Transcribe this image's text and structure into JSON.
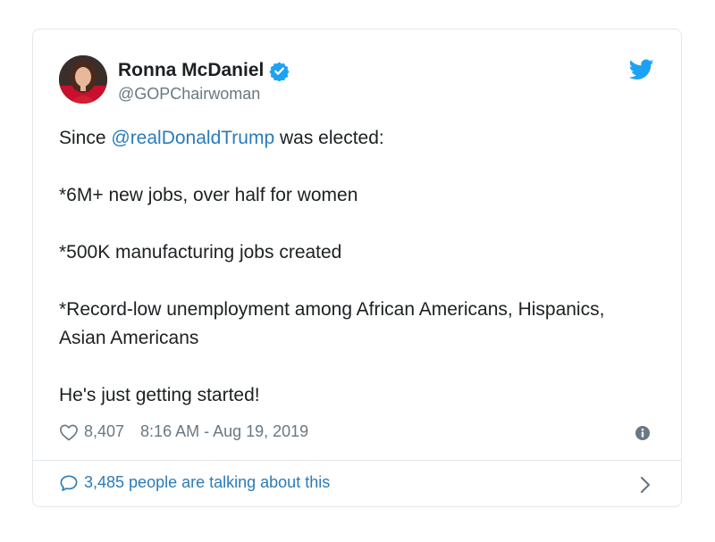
{
  "tweet": {
    "display_name": "Ronna McDaniel",
    "handle": "@GOPChairwoman",
    "verified": true,
    "text_prefix": "Since ",
    "mention": "@realDonaldTrump",
    "text_suffix": " was elected:",
    "line2": "*6M+ new jobs, over half for women",
    "line3": "*500K manufacturing jobs created",
    "line4": "*Record-low unemployment among African Americans, Hispanics, Asian Americans",
    "line5": "He's just getting started!",
    "likes": "8,407",
    "timestamp": "8:16 AM - Aug 19, 2019",
    "talking": "3,485 people are talking about this"
  },
  "icons": {
    "brand": "twitter-bird-icon",
    "verified": "verified-badge-icon",
    "like": "heart-icon",
    "info": "info-icon",
    "reply": "speech-bubble-icon",
    "more": "chevron-right-icon"
  },
  "colors": {
    "accent": "#1da1f2",
    "link": "#2b7bb9",
    "muted": "#697882",
    "text": "#1c2022",
    "border": "#e1e8ed"
  }
}
